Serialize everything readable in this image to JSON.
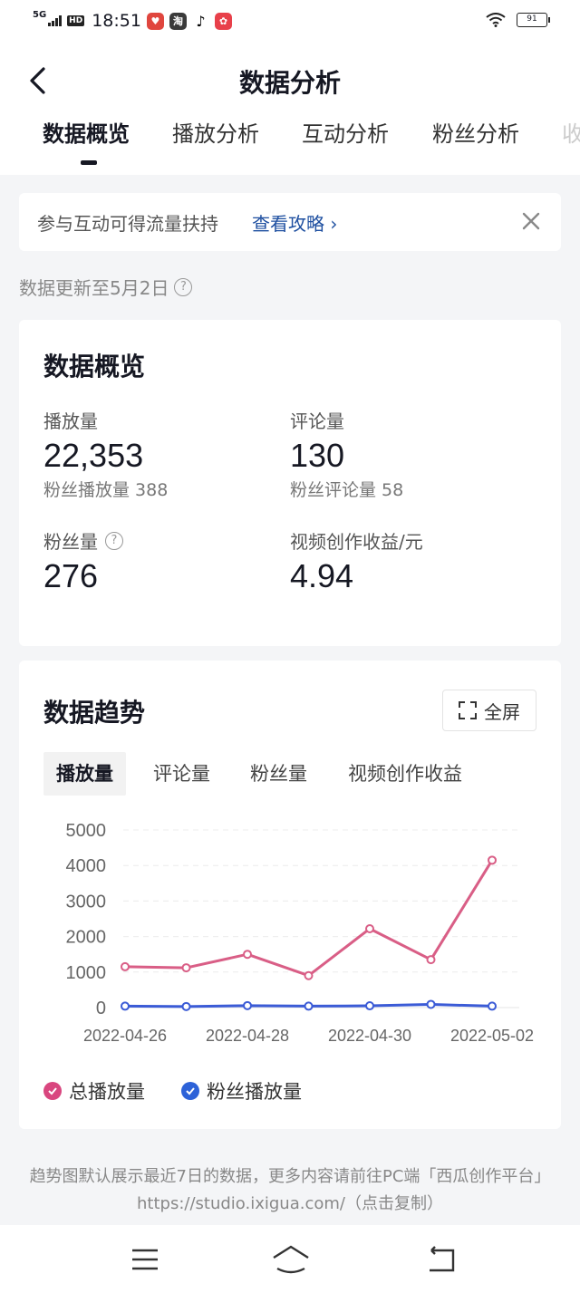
{
  "status_bar": {
    "network": "5G",
    "hd": "HD",
    "time": "18:51",
    "battery": "91",
    "app_icons": [
      "taobao-heart-icon",
      "taobao-icon",
      "tiktok-icon",
      "app-icon"
    ]
  },
  "header": {
    "title": "数据分析",
    "tabs": [
      "数据概览",
      "播放分析",
      "互动分析",
      "粉丝分析",
      "收"
    ]
  },
  "banner": {
    "text": "参与互动可得流量扶持",
    "link": "查看攻略",
    "link_arrow": "›"
  },
  "update_note": "数据更新至5月2日",
  "overview": {
    "title": "数据概览",
    "metrics": [
      {
        "label": "播放量",
        "value": "22,353",
        "sub": "粉丝播放量 388"
      },
      {
        "label": "评论量",
        "value": "130",
        "sub": "粉丝评论量 58"
      },
      {
        "label": "粉丝量",
        "value": "276",
        "sub": ""
      },
      {
        "label": "视频创作收益/元",
        "value": "4.94",
        "sub": ""
      }
    ]
  },
  "trend": {
    "title": "数据趋势",
    "fullscreen": "全屏",
    "tabs": [
      "播放量",
      "评论量",
      "粉丝量",
      "视频创作收益"
    ]
  },
  "chart_data": {
    "type": "line",
    "title": "",
    "xlabel": "",
    "ylabel": "",
    "x": [
      "2022-04-26",
      "2022-04-27",
      "2022-04-28",
      "2022-04-29",
      "2022-04-30",
      "2022-05-01",
      "2022-05-02"
    ],
    "x_tick_labels": [
      "2022-04-26",
      "2022-04-28",
      "2022-04-30",
      "2022-05-02"
    ],
    "y_ticks": [
      0,
      1000,
      2000,
      3000,
      4000,
      5000
    ],
    "ylim": [
      0,
      5000
    ],
    "grid": true,
    "legend_position": "bottom-left",
    "series": [
      {
        "name": "总播放量",
        "color": "#d95e86",
        "values": [
          1150,
          1120,
          1500,
          900,
          2220,
          1350,
          4150
        ]
      },
      {
        "name": "粉丝播放量",
        "color": "#3b5bd6",
        "values": [
          40,
          30,
          55,
          40,
          50,
          90,
          40
        ]
      }
    ]
  },
  "footer": {
    "line1": "趋势图默认展示最近7日的数据，更多内容请前往PC端「西瓜创作平台」",
    "line2": "https://studio.ixigua.com/（点击复制）"
  }
}
